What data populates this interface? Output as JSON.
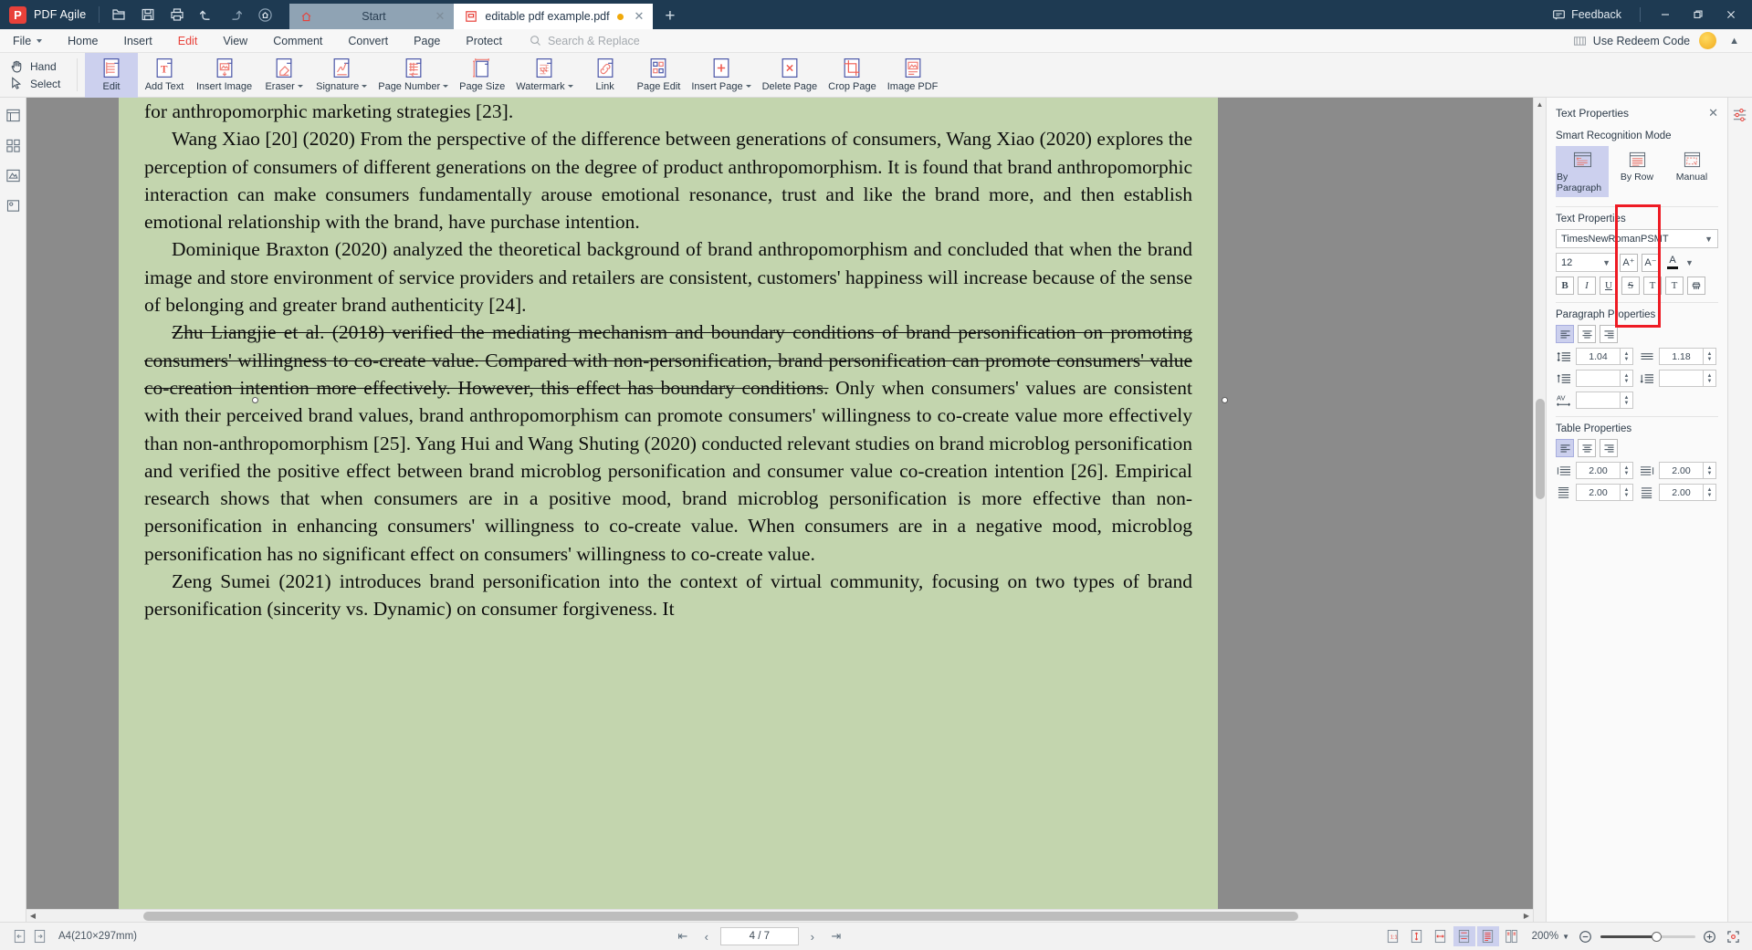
{
  "app": {
    "brand": "PDF Agile",
    "logo_letter": "P",
    "accent": "#e8413a",
    "titlebar_bg": "#1e3a52"
  },
  "titlebar": {
    "quick_icons": [
      {
        "name": "open-file-icon",
        "glyph": "open"
      },
      {
        "name": "save-icon",
        "glyph": "save"
      },
      {
        "name": "print-icon",
        "glyph": "print"
      },
      {
        "name": "undo-icon",
        "glyph": "undo"
      },
      {
        "name": "redo-icon",
        "glyph": "redo"
      },
      {
        "name": "home-icon",
        "glyph": "home"
      }
    ],
    "tabs": [
      {
        "label": "Start",
        "active": false,
        "modified": false
      },
      {
        "label": "editable pdf example.pdf",
        "active": true,
        "modified": true
      }
    ],
    "new_tab_label": "+",
    "feedback_label": "Feedback",
    "window_buttons": {
      "minimize": "–",
      "maximize": "❐",
      "close": "✕"
    }
  },
  "menubar": {
    "items": [
      {
        "label": "File",
        "active": false,
        "has_caret": true
      },
      {
        "label": "Home",
        "active": false,
        "has_caret": false
      },
      {
        "label": "Insert",
        "active": false,
        "has_caret": false
      },
      {
        "label": "Edit",
        "active": true,
        "has_caret": false
      },
      {
        "label": "View",
        "active": false,
        "has_caret": false
      },
      {
        "label": "Comment",
        "active": false,
        "has_caret": false
      },
      {
        "label": "Convert",
        "active": false,
        "has_caret": false
      },
      {
        "label": "Page",
        "active": false,
        "has_caret": false
      },
      {
        "label": "Protect",
        "active": false,
        "has_caret": false
      }
    ],
    "search_placeholder": "Search & Replace",
    "redeem_label": "Use Redeem Code"
  },
  "ribbon": {
    "hand_label": "Hand",
    "select_label": "Select",
    "buttons": [
      {
        "label": "Edit",
        "icon": "edit-text-icon",
        "selected": true,
        "caret": false
      },
      {
        "label": "Add Text",
        "icon": "add-text-icon",
        "selected": false,
        "caret": false
      },
      {
        "label": "Insert Image",
        "icon": "insert-image-icon",
        "selected": false,
        "caret": false
      },
      {
        "label": "Eraser",
        "icon": "eraser-icon",
        "selected": false,
        "caret": true
      },
      {
        "label": "Signature",
        "icon": "signature-icon",
        "selected": false,
        "caret": true
      },
      {
        "label": "Page Number",
        "icon": "page-number-icon",
        "selected": false,
        "caret": true
      },
      {
        "label": "Page Size",
        "icon": "page-size-icon",
        "selected": false,
        "caret": false
      },
      {
        "label": "Watermark",
        "icon": "watermark-icon",
        "selected": false,
        "caret": true
      },
      {
        "label": "Link",
        "icon": "link-icon",
        "selected": false,
        "caret": false
      },
      {
        "label": "Page Edit",
        "icon": "page-edit-icon",
        "selected": false,
        "caret": false
      },
      {
        "label": "Insert Page",
        "icon": "insert-page-icon",
        "selected": false,
        "caret": true
      },
      {
        "label": "Delete Page",
        "icon": "delete-page-icon",
        "selected": false,
        "caret": false
      },
      {
        "label": "Crop Page",
        "icon": "crop-page-icon",
        "selected": false,
        "caret": false
      },
      {
        "label": "Image PDF",
        "icon": "image-pdf-icon",
        "selected": false,
        "caret": false
      }
    ]
  },
  "left_rail": [
    {
      "name": "thumbnails-icon"
    },
    {
      "name": "page-grid-icon"
    },
    {
      "name": "annotation-icon"
    },
    {
      "name": "stamp-icon"
    }
  ],
  "document": {
    "highlight_color": "#c3d5ae",
    "paragraphs": [
      {
        "text": "for anthropomorphic marketing strategies [23].",
        "indent": false,
        "strike": false
      },
      {
        "text": "Wang Xiao [20] (2020) From the perspective of the difference between generations of consumers, Wang Xiao (2020) explores the perception of consumers of different generations on the degree of product anthropomorphism. It is found that brand anthropomorphic interaction can make consumers fundamentally arouse emotional resonance, trust and like the brand more, and then establish emotional relationship with the brand, have purchase intention.",
        "indent": true,
        "strike": false
      },
      {
        "text": "Dominique Braxton (2020) analyzed the theoretical background of brand anthropomorphism and concluded that when the brand image and store environment of service providers and retailers are consistent, customers' happiness will increase because of the sense of belonging and greater brand authenticity [24].",
        "indent": true,
        "strike": false
      },
      {
        "strike_text": "Zhu Liangjie et al. (2018) verified the mediating mechanism and boundary conditions of brand personification on promoting consumers' willingness to co-create value. Compared with non-personification, brand personification can promote consumers' value co-creation intention more effectively. However, this effect has boundary conditions.",
        "text": " Only when consumers' values are consistent with their perceived brand values, brand anthropomorphism can promote consumers' willingness to co-create value more effectively than non-anthropomorphism [25]. Yang Hui and Wang Shuting (2020) conducted relevant studies on brand microblog personification and verified the positive effect between brand microblog personification and consumer value co-creation intention [26]. Empirical research shows that when consumers are in a positive mood, brand microblog personification is more effective than non-personification in enhancing consumers' willingness to co-create value. When consumers are in a negative mood, microblog personification has no significant effect on consumers' willingness to co-create value.",
        "indent": true,
        "strike": true
      },
      {
        "text": "Zeng Sumei (2021) introduces brand personification into the context of virtual community, focusing on two types of brand personification (sincerity vs. Dynamic) on consumer forgiveness. It",
        "indent": true,
        "strike": false
      }
    ]
  },
  "right_panel": {
    "title": "Text Properties",
    "smart_recognition": {
      "label": "Smart Recognition Mode",
      "modes": [
        {
          "label": "By Paragraph",
          "selected": true,
          "icon": "by-paragraph-icon"
        },
        {
          "label": "By Row",
          "selected": false,
          "icon": "by-row-icon"
        },
        {
          "label": "Manual",
          "selected": false,
          "icon": "manual-select-icon"
        }
      ]
    },
    "text_properties": {
      "label": "Text Properties",
      "font_family": "TimesNewRomanPSMT",
      "font_size": "12",
      "increase_font_label": "A⁺",
      "decrease_font_label": "A⁻",
      "bold_label": "B",
      "italic_label": "I",
      "underline_label": "U",
      "strikethrough_label": "S",
      "superscript_label": "T",
      "subscript_label": "T",
      "format_brush_label": "brush"
    },
    "paragraph_properties": {
      "label": "Paragraph Properties",
      "align_left_selected": true,
      "line_spacing": "1.04",
      "char_spacing": "1.18",
      "space_before": "",
      "space_after": "",
      "kerning_label": "AV",
      "kerning": ""
    },
    "table_properties": {
      "label": "Table Properties",
      "align_left_selected": true,
      "margin_left": "2.00",
      "margin_right": "2.00",
      "margin_top": "2.00",
      "margin_bottom": "2.00"
    },
    "highlight_rect_color": "#ee1b24"
  },
  "statusbar": {
    "page_size": "A4(210×297mm)",
    "prev_page_icon": "previous-page-icon",
    "next_page_icon": "next-page-icon",
    "page_indicator": "4 / 7",
    "zoom_level": "200%",
    "view_modes": [
      {
        "name": "actual-size-icon",
        "selected": false
      },
      {
        "name": "fit-page-icon",
        "selected": false
      },
      {
        "name": "fit-width-icon",
        "selected": false
      },
      {
        "name": "single-page-icon",
        "selected": true
      },
      {
        "name": "continuous-scroll-icon",
        "selected": true
      },
      {
        "name": "two-page-icon",
        "selected": false
      }
    ]
  }
}
